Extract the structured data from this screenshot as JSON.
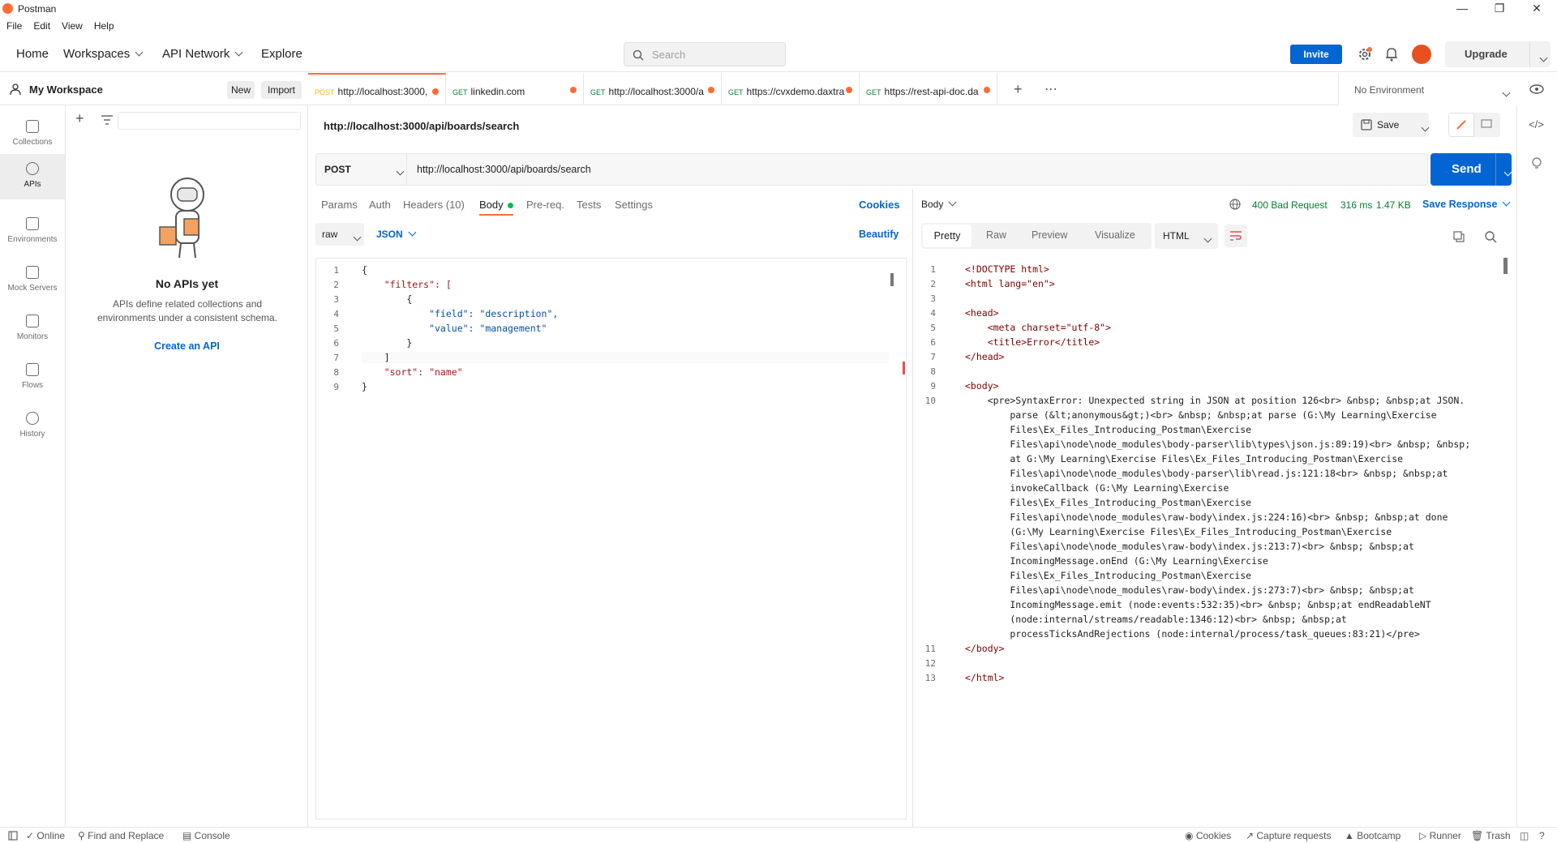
{
  "app": {
    "title": "Postman"
  },
  "menu": [
    "File",
    "Edit",
    "View",
    "Help"
  ],
  "header": {
    "nav": [
      "Home",
      "Workspaces",
      "API Network",
      "Explore"
    ],
    "search_placeholder": "Search",
    "invite_label": "Invite",
    "upgrade_label": "Upgrade"
  },
  "workspace": {
    "name": "My Workspace",
    "new_label": "New",
    "import_label": "Import"
  },
  "tabs": [
    {
      "method": "POST",
      "label": "http://localhost:3000,",
      "method_color": "#ffb400"
    },
    {
      "method": "GET",
      "label": "linkedin.com",
      "method_color": "#007f31"
    },
    {
      "method": "GET",
      "label": "http://localhost:3000/a",
      "method_color": "#007f31"
    },
    {
      "method": "GET",
      "label": "https://cvxdemo.daxtra",
      "method_color": "#007f31"
    },
    {
      "method": "GET",
      "label": "https://rest-api-doc.da",
      "method_color": "#007f31"
    }
  ],
  "environment": "No Environment",
  "left_nav": [
    {
      "label": "Collections"
    },
    {
      "label": "APIs"
    },
    {
      "label": "Environments"
    },
    {
      "label": "Mock Servers"
    },
    {
      "label": "Monitors"
    },
    {
      "label": "Flows"
    },
    {
      "label": "History"
    }
  ],
  "empty_state": {
    "title": "No APIs yet",
    "description": "APIs define related collections and environments under a consistent schema.",
    "create_link": "Create an API"
  },
  "request": {
    "title": "http://localhost:3000/api/boards/search",
    "method": "POST",
    "url": "http://localhost:3000/api/boards/search",
    "save_label": "Save",
    "send_label": "Send",
    "subtabs": [
      "Params",
      "Auth",
      "Headers (10)",
      "Body",
      "Pre-req.",
      "Tests",
      "Settings"
    ],
    "cookies_label": "Cookies",
    "body_mode": "raw",
    "body_lang": "JSON",
    "beautify_label": "Beautify",
    "body_lines": [
      "{",
      "    \"filters\": [",
      "        {",
      "            \"field\": \"description\",",
      "            \"value\": \"management\"",
      "        }",
      "    ]",
      "    \"sort\": \"name\"",
      "}"
    ]
  },
  "response": {
    "body_label": "Body",
    "status": "400 Bad Request",
    "time": "316 ms",
    "size": "1.47 KB",
    "save_response_label": "Save Response",
    "views": [
      "Pretty",
      "Raw",
      "Preview",
      "Visualize"
    ],
    "format": "HTML",
    "lines": [
      {
        "n": "1",
        "text": "<!DOCTYPE html>"
      },
      {
        "n": "2",
        "text": "<html lang=\"en\">"
      },
      {
        "n": "3",
        "text": ""
      },
      {
        "n": "4",
        "text": "<head>"
      },
      {
        "n": "5",
        "text": "    <meta charset=\"utf-8\">"
      },
      {
        "n": "6",
        "text": "    <title>Error</title>"
      },
      {
        "n": "7",
        "text": "</head>"
      },
      {
        "n": "8",
        "text": ""
      },
      {
        "n": "9",
        "text": "<body>"
      },
      {
        "n": "10",
        "text": "    <pre>SyntaxError: Unexpected string in JSON at position 126<br> &nbsp; &nbsp;at JSON."
      },
      {
        "n": "",
        "text": "        parse (&lt;anonymous&gt;)<br> &nbsp; &nbsp;at parse (G:\\My Learning\\Exercise"
      },
      {
        "n": "",
        "text": "        Files\\Ex_Files_Introducing_Postman\\Exercise"
      },
      {
        "n": "",
        "text": "        Files\\api\\node\\node_modules\\body-parser\\lib\\types\\json.js:89:19)<br> &nbsp; &nbsp;"
      },
      {
        "n": "",
        "text": "        at G:\\My Learning\\Exercise Files\\Ex_Files_Introducing_Postman\\Exercise"
      },
      {
        "n": "",
        "text": "        Files\\api\\node\\node_modules\\body-parser\\lib\\read.js:121:18<br> &nbsp; &nbsp;at"
      },
      {
        "n": "",
        "text": "        invokeCallback (G:\\My Learning\\Exercise"
      },
      {
        "n": "",
        "text": "        Files\\Ex_Files_Introducing_Postman\\Exercise"
      },
      {
        "n": "",
        "text": "        Files\\api\\node\\node_modules\\raw-body\\index.js:224:16)<br> &nbsp; &nbsp;at done"
      },
      {
        "n": "",
        "text": "        (G:\\My Learning\\Exercise Files\\Ex_Files_Introducing_Postman\\Exercise"
      },
      {
        "n": "",
        "text": "        Files\\api\\node\\node_modules\\raw-body\\index.js:213:7)<br> &nbsp; &nbsp;at"
      },
      {
        "n": "",
        "text": "        IncomingMessage.onEnd (G:\\My Learning\\Exercise"
      },
      {
        "n": "",
        "text": "        Files\\Ex_Files_Introducing_Postman\\Exercise"
      },
      {
        "n": "",
        "text": "        Files\\api\\node\\node_modules\\raw-body\\index.js:273:7)<br> &nbsp; &nbsp;at"
      },
      {
        "n": "",
        "text": "        IncomingMessage.emit (node:events:532:35)<br> &nbsp; &nbsp;at endReadableNT"
      },
      {
        "n": "",
        "text": "        (node:internal/streams/readable:1346:12)<br> &nbsp; &nbsp;at"
      },
      {
        "n": "",
        "text": "        processTicksAndRejections (node:internal/process/task_queues:83:21)</pre>"
      },
      {
        "n": "11",
        "text": "</body>"
      },
      {
        "n": "12",
        "text": ""
      },
      {
        "n": "13",
        "text": "</html>"
      }
    ]
  },
  "footer": {
    "left": [
      "Online",
      "Find and Replace",
      "Console"
    ],
    "right": [
      "Cookies",
      "Capture requests",
      "Bootcamp",
      "Runner",
      "Trash"
    ]
  }
}
